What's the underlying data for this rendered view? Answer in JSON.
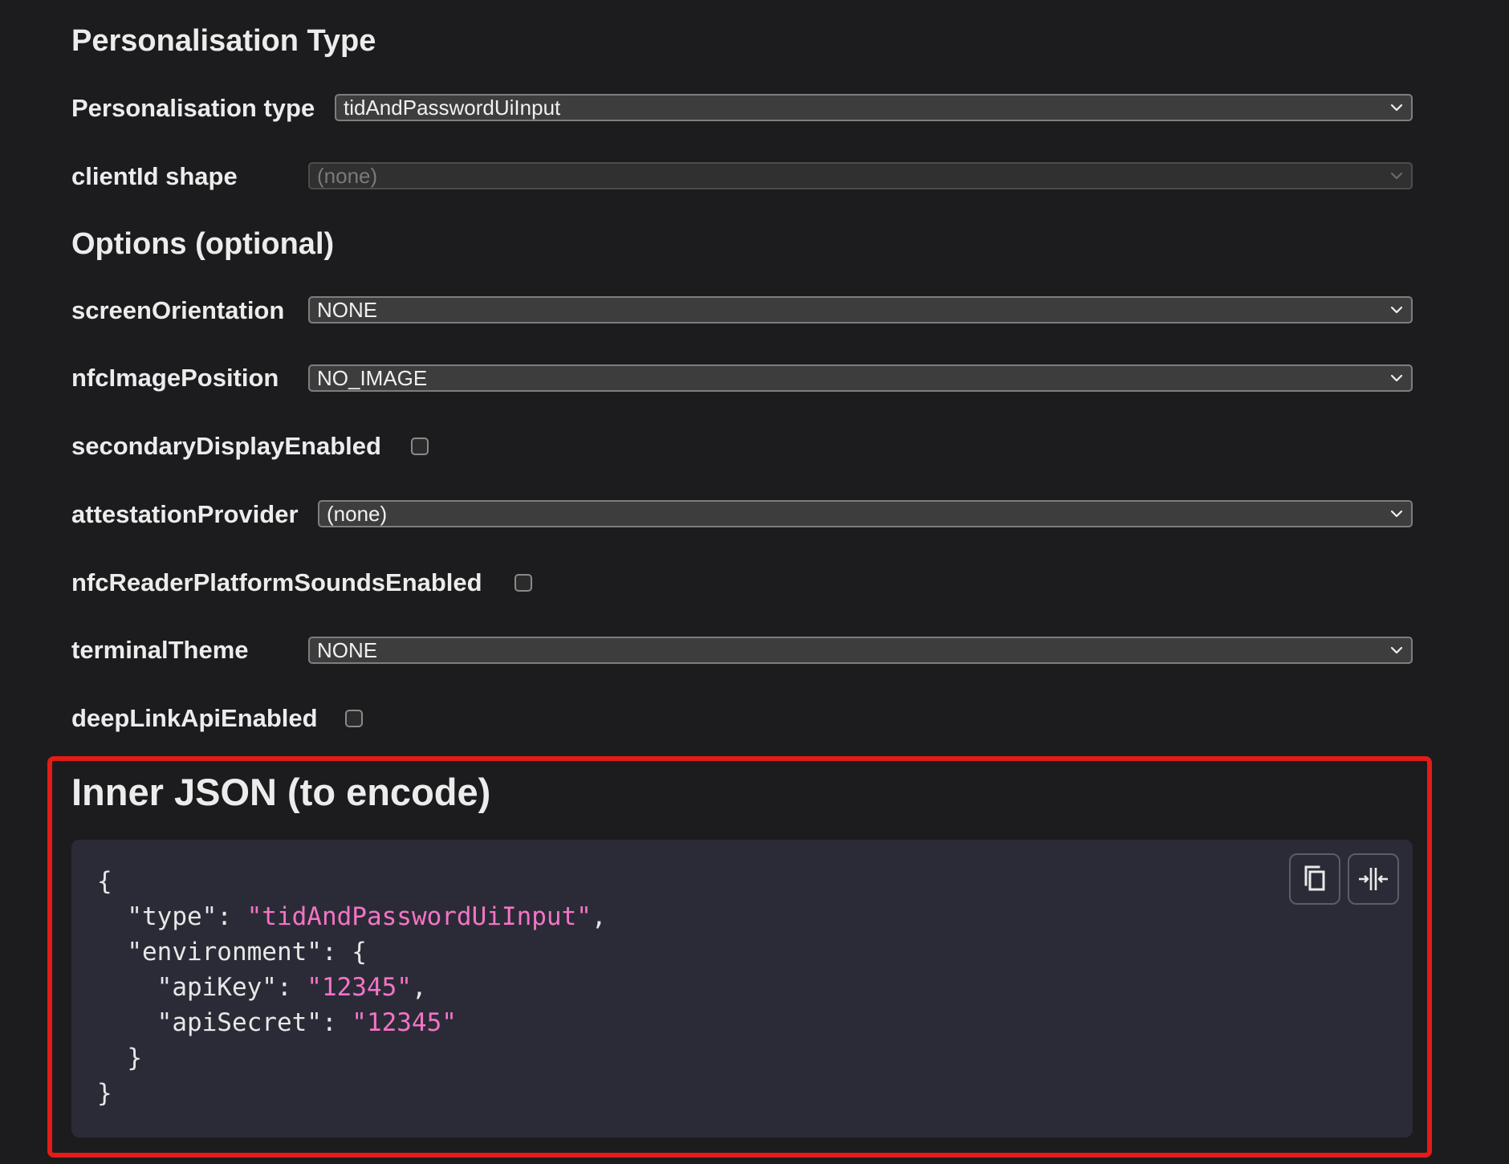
{
  "personalisation": {
    "heading": "Personalisation Type",
    "type_label": "Personalisation type",
    "type_value": "tidAndPasswordUiInput",
    "client_shape_label": "clientId shape",
    "client_shape_value": "(none)"
  },
  "options": {
    "heading": "Options (optional)",
    "screen_orientation_label": "screenOrientation",
    "screen_orientation_value": "NONE",
    "nfc_image_position_label": "nfcImagePosition",
    "nfc_image_position_value": "NO_IMAGE",
    "secondary_display_label": "secondaryDisplayEnabled",
    "secondary_display_checked": false,
    "attestation_provider_label": "attestationProvider",
    "attestation_provider_value": "(none)",
    "nfc_reader_sounds_label": "nfcReaderPlatformSoundsEnabled",
    "nfc_reader_sounds_checked": false,
    "terminal_theme_label": "terminalTheme",
    "terminal_theme_value": "NONE",
    "deep_link_label": "deepLinkApiEnabled",
    "deep_link_checked": false
  },
  "inner_json": {
    "heading": "Inner JSON (to encode)",
    "lines": {
      "open": "{",
      "type_key": "  \"type\": ",
      "type_val": "\"tidAndPasswordUiInput\"",
      "type_end": ",",
      "env_key": "  \"environment\": {",
      "apikey_key": "    \"apiKey\": ",
      "apikey_val": "\"12345\"",
      "apikey_end": ",",
      "apisecret_key": "    \"apiSecret\": ",
      "apisecret_val": "\"12345\"",
      "env_close": "  }",
      "close": "}"
    },
    "copy_icon": "copy-icon",
    "collapse_icon": "collapse-icon"
  },
  "colors": {
    "background": "#1c1c1e",
    "highlight_border": "#e41b17",
    "string_color": "#f474c6",
    "code_background": "#2b2b37"
  }
}
